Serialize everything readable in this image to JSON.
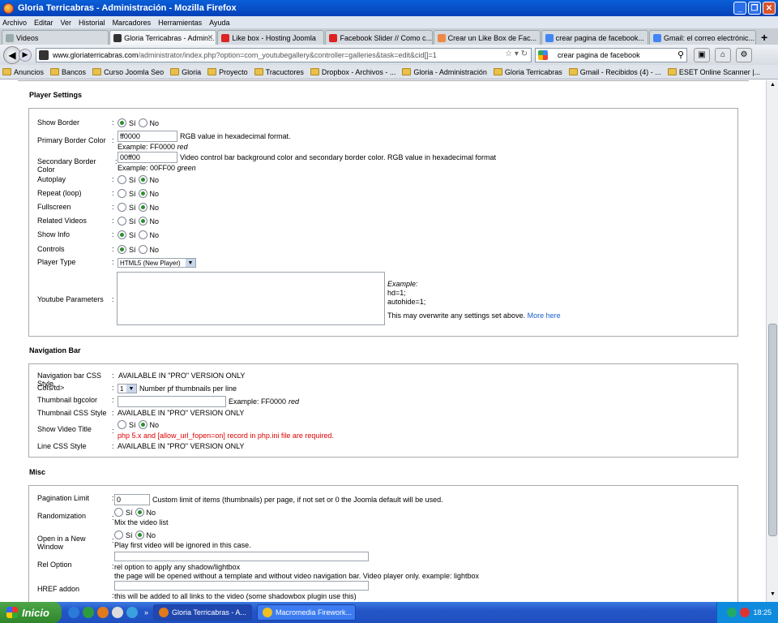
{
  "window": {
    "title": "Gloria Terricabras - Administración - Mozilla Firefox"
  },
  "menu": [
    "Archivo",
    "Editar",
    "Ver",
    "Historial",
    "Marcadores",
    "Herramientas",
    "Ayuda"
  ],
  "tabs": [
    {
      "label": "Videos",
      "fav": "#9aa"
    },
    {
      "label": "Gloria Terricabras - Admin...",
      "fav": "#333",
      "active": true
    },
    {
      "label": "Like box - Hosting Joomla",
      "fav": "#d22"
    },
    {
      "label": "Facebook Slider // Como c...",
      "fav": "#d22"
    },
    {
      "label": "Crear un Like Box de Fac...",
      "fav": "#e84"
    },
    {
      "label": "crear pagina de facebook...",
      "fav": "#4285f4"
    },
    {
      "label": "Gmail: el correo electrónic...",
      "fav": "#4285f4"
    }
  ],
  "nav": {
    "url_host": "www.gloriaterricabras.com",
    "url_path": "/administrator/index.php?option=com_youtubegallery&controller=galleries&task=edit&cid[]=1",
    "search_value": "crear pagina de facebook"
  },
  "bookmarks": [
    "Anuncios",
    "Bancos",
    "Curso Joomla Seo",
    "Gloria",
    "Proyecto",
    "Tracuctores",
    "Dropbox - Archivos - ...",
    "Gloria - Administración",
    "Gloria Terricabras",
    "Gmail - Recibidos (4) - ...",
    "ESET Online Scanner |..."
  ],
  "player": {
    "legend": "Player Settings",
    "yes": "Sí",
    "no": "No",
    "show_border": "Show Border",
    "primary_color": "Primary Border Color",
    "primary_value": "ff0000",
    "primary_hint": "RGB value in hexadecimal format.",
    "primary_example": "Example: FF0000",
    "primary_example_word": "red",
    "secondary_color": "Secondary Border Color",
    "secondary_value": "00ff00",
    "secondary_hint": "Video control bar background color and secondary border color. RGB value in hexadecimal format",
    "secondary_example": "Example: 00FF00",
    "secondary_example_word": "green",
    "autoplay": "Autoplay",
    "repeat": "Repeat (loop)",
    "fullscreen": "Fullscreen",
    "related": "Related Videos",
    "showinfo": "Show Info",
    "controls": "Controls",
    "player_type": "Player Type",
    "player_type_value": "HTML5 (New Player)",
    "yt_params": "Youtube Parameters",
    "example_label": "Example:",
    "example_line1": "hd=1;",
    "example_line2": "autohide=1;",
    "overwrite_note": "This may overwrite any settings set above.",
    "more_here": "More here"
  },
  "navbar_section": {
    "legend": "Navigation Bar",
    "css_style": "Navigation bar CSS Style",
    "pro": "AVAILABLE IN \"PRO\" VERSION ONLY",
    "cols": "Cols/td>",
    "cols_value": "1",
    "cols_hint": "Number pf thumbnails per line",
    "thumb_bg": "Thumbnail bgcolor",
    "thumb_bg_example": "Example: FF0000",
    "thumb_bg_example_word": "red",
    "thumb_css": "Thumbnail CSS Style",
    "show_title": "Show Video Title",
    "php_warning": "php 5.x and [allow_url_fopen=on] record in php.ini file are required.",
    "line_css": "Line CSS Style"
  },
  "misc": {
    "legend": "Misc",
    "pagination": "Pagination Limit",
    "pagination_value": "0",
    "pagination_hint": "Custom limit of items (thumbnails) per page, if not set or 0 the Joomla default will be used.",
    "randomization": "Randomization",
    "random_hint": "Mix the video list",
    "new_window": "Open in a New Window",
    "new_window_hint": "Play first video will be ignored in this case.",
    "rel": "Rel Option",
    "rel_hint1": "rel option to apply any shadow/lightbox",
    "rel_hint2": "the page will be opened without a template and without video navigation bar. Video player only. example: lightbox",
    "href": "HREF addon",
    "href_hint": "this will be added to all links to the video (some shadowbox plugin use this)"
  },
  "taskbar": {
    "start": "Inicio",
    "task1": "Gloria Terricabras - A...",
    "task2": "Macromedia Firework...",
    "clock": "18:25"
  }
}
